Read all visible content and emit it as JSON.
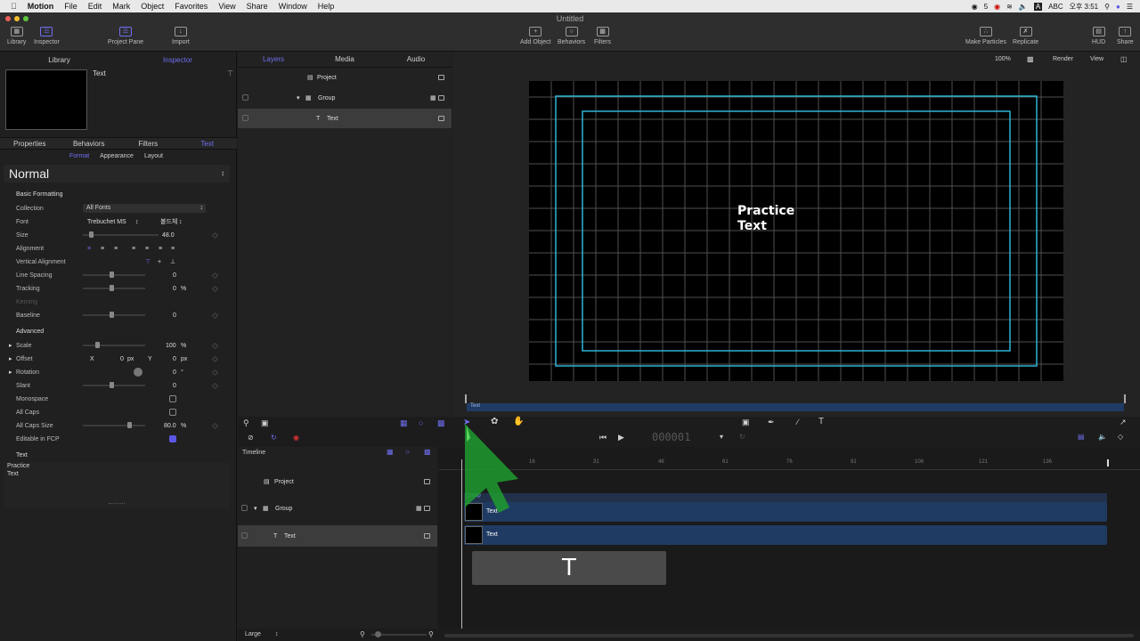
{
  "menubar": {
    "app_name": "Motion",
    "items": [
      "File",
      "Edit",
      "Mark",
      "Object",
      "Favorites",
      "View",
      "Share",
      "Window",
      "Help"
    ],
    "status": [
      "5",
      "A",
      "ABC",
      "오후 3:51"
    ]
  },
  "window": {
    "title": "Untitled"
  },
  "toolbar": {
    "library": "Library",
    "inspector": "Inspector",
    "project_pane": "Project Pane",
    "import": "Import",
    "add_object": "Add Object",
    "behaviors": "Behaviors",
    "filters": "Filters",
    "make_particles": "Make Particles",
    "replicate": "Replicate",
    "hud": "HUD",
    "share": "Share"
  },
  "left_panel": {
    "tabs": [
      "Library",
      "Inspector"
    ],
    "active_tab": "Inspector",
    "preview_title": "Text",
    "inspector_tabs": [
      "Properties",
      "Behaviors",
      "Filters",
      "Text"
    ],
    "sub_tabs": [
      "Format",
      "Appearance",
      "Layout"
    ],
    "preset": "Normal",
    "basic_formatting": "Basic Formatting",
    "collection_label": "Collection",
    "collection_value": "All Fonts",
    "font_label": "Font",
    "font_value": "Trebuchet MS",
    "font_style": "볼드체",
    "size_label": "Size",
    "size_value": "48.0",
    "alignment_label": "Alignment",
    "valign_label": "Vertical Alignment",
    "line_spacing_label": "Line Spacing",
    "line_spacing_value": "0",
    "tracking_label": "Tracking",
    "tracking_value": "0",
    "tracking_unit": "%",
    "kerning_label": "Kerning",
    "baseline_label": "Baseline",
    "baseline_value": "0",
    "advanced": "Advanced",
    "scale_label": "Scale",
    "scale_value": "100",
    "scale_unit": "%",
    "offset_label": "Offset",
    "offset_x_label": "X",
    "offset_x": "0",
    "offset_y_label": "Y",
    "offset_y": "0",
    "offset_unit": "px",
    "rotation_label": "Rotation",
    "rotation_value": "0",
    "rotation_unit": "°",
    "slant_label": "Slant",
    "slant_value": "0",
    "monospace_label": "Monospace",
    "allcaps_label": "All Caps",
    "allcaps_size_label": "All Caps Size",
    "allcaps_size_value": "80.0",
    "allcaps_size_unit": "%",
    "editable_label": "Editable in FCP",
    "text_section": "Text",
    "text_line1": "Practice",
    "text_line2": "Text"
  },
  "layers_panel": {
    "tabs": [
      "Layers",
      "Media",
      "Audio"
    ],
    "project": "Project",
    "group": "Group",
    "text": "Text"
  },
  "canvas_bar": {
    "zoom": "100%",
    "render": "Render",
    "view": "View"
  },
  "canvas": {
    "text_line1": "Practice",
    "text_line2": "Text"
  },
  "mini_timeline": {
    "label": "Text"
  },
  "transport": {
    "timecode": "000001"
  },
  "timeline": {
    "title": "Timeline",
    "project": "Project",
    "group": "Group",
    "text": "Text",
    "ruler": [
      "16",
      "31",
      "46",
      "61",
      "76",
      "91",
      "106",
      "121",
      "136"
    ],
    "group_label": "Group",
    "bar_text_1": "Text",
    "bar_text_2": "Text",
    "drag_glyph": "T",
    "size_label": "Large"
  },
  "colors": {
    "accent": "#6f6ef0",
    "safe_zone": "#2fb4d6",
    "bar": "#1f3b64"
  }
}
